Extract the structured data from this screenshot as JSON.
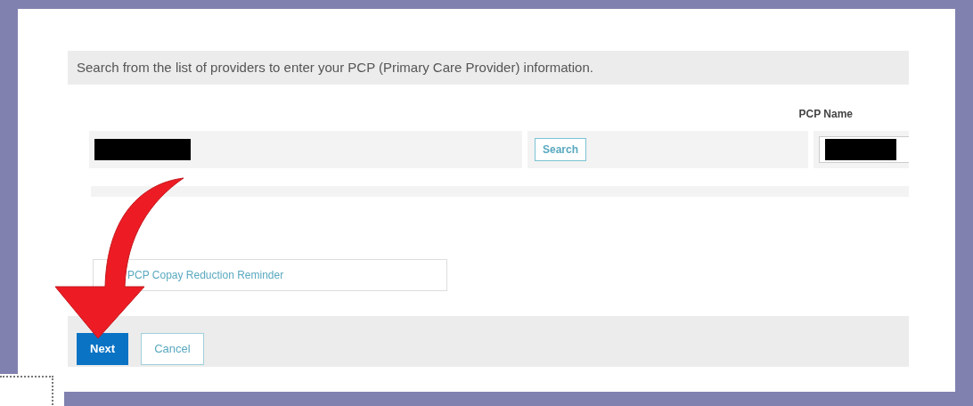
{
  "instruction": "Search from the list of providers to enter your PCP (Primary Care Provider) information.",
  "column_header": "PCP Name",
  "search_button": "Search",
  "reminder_link": "PCP Copay Reduction Reminder",
  "buttons": [
    {
      "label": "Next",
      "kind": "primary"
    },
    {
      "label": "Cancel",
      "kind": "secondary"
    }
  ]
}
